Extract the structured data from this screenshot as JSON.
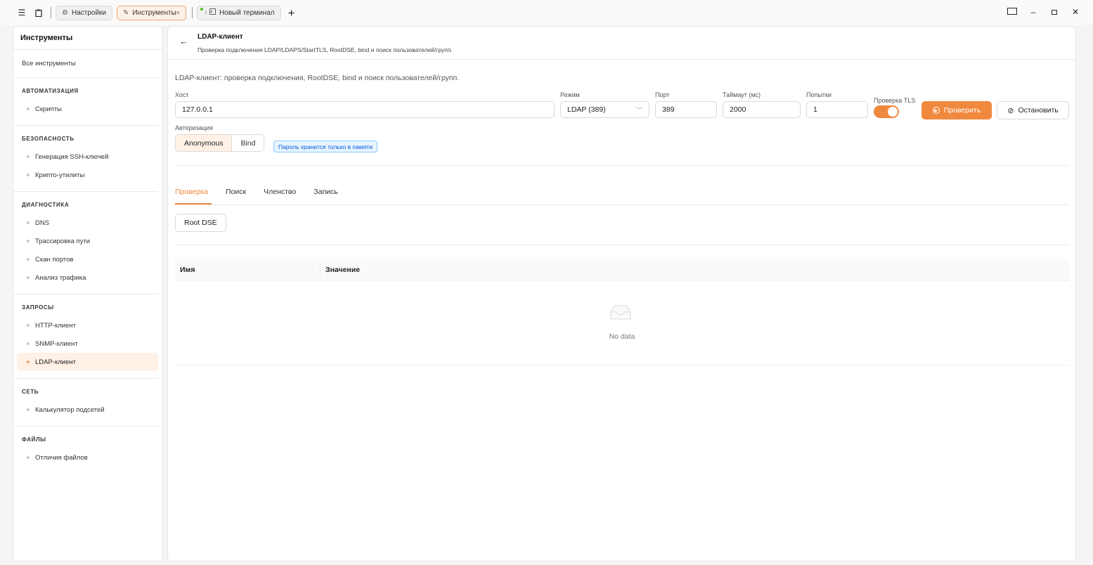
{
  "titlebar": {
    "tabs": [
      {
        "label": "Настройки",
        "icon": "gear-icon"
      },
      {
        "label": "Инструменты",
        "icon": "tools-icon",
        "close": "×"
      },
      {
        "label": "Новый терминал",
        "icon": "terminal-icon",
        "number": "1"
      }
    ],
    "menu_icon": "☰",
    "plus": "+"
  },
  "sidebar": {
    "title": "Инструменты",
    "all_label": "Все инструменты",
    "sections": [
      {
        "head": "АВТОМАТИЗАЦИЯ",
        "items": [
          "Скрипты"
        ]
      },
      {
        "head": "БЕЗОПАСНОСТЬ",
        "items": [
          "Генерация SSH-ключей",
          "Крипто-утилиты"
        ]
      },
      {
        "head": "ДИАГНОСТИКА",
        "items": [
          "DNS",
          "Трассировка пути",
          "Скан портов",
          "Анализ трафика"
        ]
      },
      {
        "head": "ЗАПРОСЫ",
        "items": [
          "HTTP-клиент",
          "SNMP-клиент",
          "LDAP-клиент"
        ]
      },
      {
        "head": "СЕТЬ",
        "items": [
          "Калькулятор подсетей"
        ]
      },
      {
        "head": "ФАЙЛЫ",
        "items": [
          "Отличия файлов"
        ]
      }
    ],
    "active_item": "LDAP-клиент"
  },
  "main": {
    "title": "LDAP-клиент",
    "subtitle": "Проверка подключения LDAP/LDAPS/StartTLS, RootDSE, bind и поиск пользователей/групп.",
    "description": "LDAP-клиент: проверка подключения, RootDSE, bind и поиск пользователей/групп.",
    "form": {
      "host_label": "Хост",
      "host_value": "127.0.0.1",
      "mode_label": "Режим",
      "mode_value": "LDAP (389)",
      "port_label": "Порт",
      "port_value": "389",
      "timeout_label": "Таймаут (мс)",
      "timeout_value": "2000",
      "retries_label": "Попытки",
      "retries_value": "1",
      "tls_label": "Проверка TLS",
      "tls_on": true,
      "check_button": "Проверить",
      "stop_button": "Остановить",
      "auth_label": "Авторизация",
      "auth_options": [
        "Anonymous",
        "Bind"
      ],
      "auth_selected": "Anonymous",
      "password_note": "Пароль хранится только в памяти"
    },
    "tabs": [
      "Проверка",
      "Поиск",
      "Членство",
      "Запись"
    ],
    "active_tab": "Проверка",
    "root_dse_button": "Root DSE",
    "table": {
      "columns": [
        "Имя",
        "Значение"
      ],
      "rows": [],
      "empty_text": "No data"
    }
  },
  "colors": {
    "accent": "#f0883e",
    "accent_bg": "#fff1e6",
    "info": "#0958d9"
  }
}
